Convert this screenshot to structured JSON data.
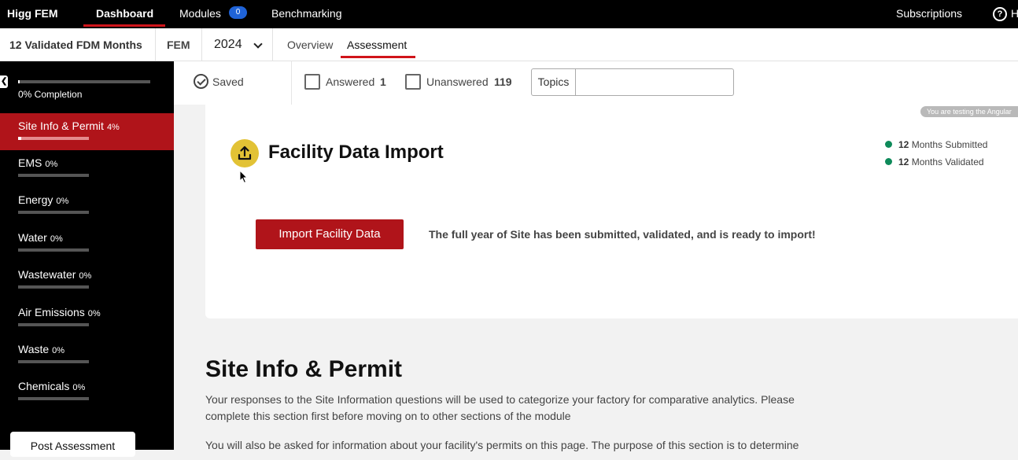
{
  "topnav": {
    "brand": "Higg FEM",
    "items": [
      {
        "label": "Dashboard"
      },
      {
        "label": "Modules",
        "badge": "0"
      },
      {
        "label": "Benchmarking"
      }
    ],
    "subscriptions": "Subscriptions",
    "help_label": "H"
  },
  "subbar": {
    "fdm": "12 Validated FDM Months",
    "module": "FEM",
    "year": "2024",
    "tabs": [
      {
        "label": "Overview"
      },
      {
        "label": "Assessment"
      }
    ]
  },
  "sidebar": {
    "completion_label": "0% Completion",
    "completion": 0.01,
    "items": [
      {
        "label": "Site Info & Permit",
        "pct": "4%",
        "progress": 0.04
      },
      {
        "label": "EMS",
        "pct": "0%",
        "progress": 0
      },
      {
        "label": "Energy",
        "pct": "0%",
        "progress": 0
      },
      {
        "label": "Water",
        "pct": "0%",
        "progress": 0
      },
      {
        "label": "Wastewater",
        "pct": "0%",
        "progress": 0
      },
      {
        "label": "Air Emissions",
        "pct": "0%",
        "progress": 0
      },
      {
        "label": "Waste",
        "pct": "0%",
        "progress": 0
      },
      {
        "label": "Chemicals",
        "pct": "0%",
        "progress": 0
      }
    ],
    "post_button": "Post Assessment"
  },
  "filters": {
    "saved": "Saved",
    "answered_label": "Answered",
    "answered_count": "1",
    "unanswered_label": "Unanswered",
    "unanswered_count": "119",
    "topics_label": "Topics",
    "topics_value": ""
  },
  "card": {
    "pill": "You are testing the Angular",
    "title": "Facility Data Import",
    "stats": [
      {
        "num": "12",
        "text": "Months Submitted"
      },
      {
        "num": "12",
        "text": "Months Validated"
      }
    ],
    "import_button": "Import Facility Data",
    "message": "The full year of Site has been submitted, validated, and is ready to import!"
  },
  "section": {
    "title": "Site Info & Permit",
    "para1": "Your responses to the Site Information questions will be used to categorize your factory for comparative analytics. Please complete this section first before moving on to other sections of the module",
    "para2": "You will also be asked for information about your facility's permits on this page. The purpose of this section is to determine"
  },
  "colors": {
    "accent": "#b0141a",
    "nav_underline": "#d0141a",
    "badge": "#1f63d8",
    "status": "#0e8a5a",
    "upload": "#e2c235"
  }
}
